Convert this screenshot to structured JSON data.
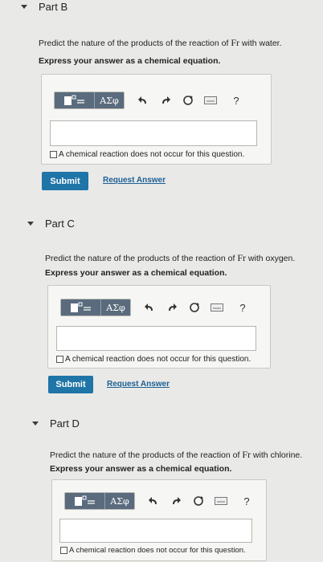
{
  "parts": [
    {
      "title": "Part B",
      "prompt_pre": "Predict the nature of the products of the reaction of ",
      "element": "Fr",
      "prompt_post": " with water.",
      "express": "Express your answer as a chemical equation.",
      "greek_label": "ΑΣφ",
      "no_reaction_label": "A chemical reaction does not occur for this question.",
      "submit_label": "Submit",
      "request_label": "Request Answer"
    },
    {
      "title": "Part C",
      "prompt_pre": "Predict the nature of the products of the reaction of ",
      "element": "Fr",
      "prompt_post": " with oxygen.",
      "express": "Express your answer as a chemical equation.",
      "greek_label": "ΑΣφ",
      "no_reaction_label": "A chemical reaction does not occur for this question.",
      "submit_label": "Submit",
      "request_label": "Request Answer"
    },
    {
      "title": "Part D",
      "prompt_pre": "Predict the nature of the products of the reaction of ",
      "element": "Fr",
      "prompt_post": " with chlorine.",
      "express": "Express your answer as a chemical equation.",
      "greek_label": "ΑΣφ",
      "no_reaction_label": "A chemical reaction does not occur for this question."
    }
  ],
  "toolbar_icons": [
    "templates-icon",
    "undo-icon",
    "redo-icon",
    "reset-icon",
    "keyboard-icon",
    "help-icon"
  ],
  "help_symbol": "?"
}
